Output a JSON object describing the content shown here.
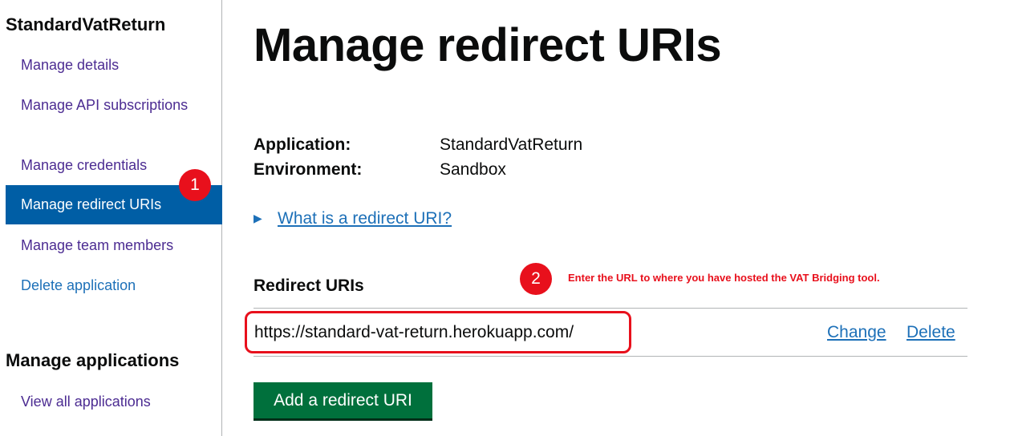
{
  "sidebar": {
    "app_heading": "StandardVatReturn",
    "items": [
      {
        "label": "Manage details"
      },
      {
        "label": "Manage API subscriptions"
      },
      {
        "label": "Manage credentials"
      },
      {
        "label": "Manage redirect URIs",
        "active": true
      },
      {
        "label": "Manage team members"
      },
      {
        "label": "Delete application"
      }
    ],
    "apps_heading": "Manage applications",
    "view_all": "View all applications"
  },
  "main": {
    "title": "Manage redirect URIs",
    "summary": {
      "application_key": "Application:",
      "application_value": "StandardVatReturn",
      "environment_key": "Environment:",
      "environment_value": "Sandbox"
    },
    "details_summary": "What is a redirect URI?",
    "section_heading": "Redirect URIs",
    "uris": [
      {
        "uri": "https://standard-vat-return.herokuapp.com/",
        "change_label": "Change",
        "delete_label": "Delete"
      }
    ],
    "add_button": "Add a redirect URI"
  },
  "annotations": {
    "badge_1": "1",
    "badge_2": "2",
    "note": "Enter the URL to where you have hosted the VAT Bridging tool.",
    "color": "#e8101c"
  },
  "colors": {
    "link": "#1d70b8",
    "visited": "#4c2c92",
    "active_nav": "#005ea5",
    "button": "#00703c"
  }
}
